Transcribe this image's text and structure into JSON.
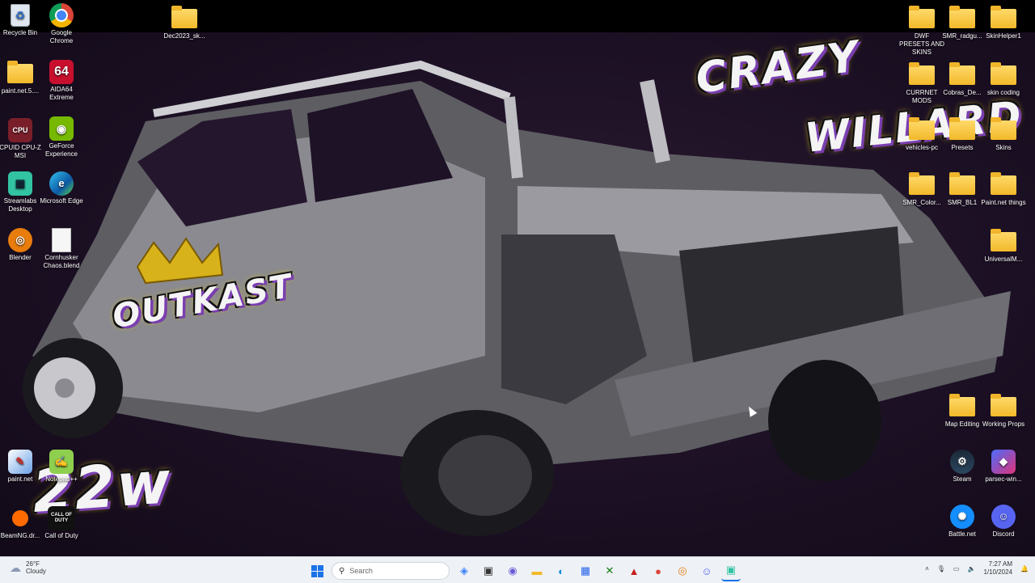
{
  "wallpaper": {
    "title_line1": "CRAZY",
    "title_line2": "WILLARD",
    "badge_text": "OUTKAST",
    "number_text": "22w",
    "accent_color": "#7a3fb0",
    "highlight_color": "#d8c21a"
  },
  "desktop_icons_left": [
    {
      "label": "Recycle Bin",
      "icon": "recycle-bin-icon"
    },
    {
      "label": "Google Chrome",
      "icon": "chrome-icon"
    },
    {
      "label": "paint.net.5....",
      "icon": "folder-icon"
    },
    {
      "label": "AIDA64 Extreme",
      "icon": "aida64-icon",
      "glyph": "64"
    },
    {
      "label": "CPUID CPU-Z MSI",
      "icon": "cpuz-icon"
    },
    {
      "label": "GeForce Experience",
      "icon": "nvidia-icon"
    },
    {
      "label": "Streamlabs Desktop",
      "icon": "streamlabs-icon"
    },
    {
      "label": "Microsoft Edge",
      "icon": "edge-icon"
    },
    {
      "label": "Blender",
      "icon": "blender-icon"
    },
    {
      "label": "Cornhusker Chaos.blend",
      "icon": "blend-file-icon"
    },
    {
      "label": "paint.net",
      "icon": "paintnet-icon"
    },
    {
      "label": "Notepad++",
      "icon": "notepadpp-icon"
    },
    {
      "label": "BeamNG.dr...",
      "icon": "beamng-icon"
    },
    {
      "label": "Call of Duty",
      "icon": "cod-icon",
      "glyph": "CALL OF DUTY"
    }
  ],
  "desktop_icon_top": {
    "label": "Dec2023_sk...",
    "icon": "folder-icon"
  },
  "desktop_icons_right": [
    {
      "label": "DWF PRESETS AND SKINS",
      "icon": "folder-icon"
    },
    {
      "label": "SMR_radgu...",
      "icon": "folder-icon"
    },
    {
      "label": "SkinHelper1",
      "icon": "folder-icon"
    },
    {
      "label": "CURRNET MODS",
      "icon": "folder-icon"
    },
    {
      "label": "Cobras_De...",
      "icon": "folder-icon"
    },
    {
      "label": "skin coding",
      "icon": "folder-icon"
    },
    {
      "label": "vehicles-pc",
      "icon": "folder-icon"
    },
    {
      "label": "Presets",
      "icon": "folder-icon"
    },
    {
      "label": "Skins",
      "icon": "folder-icon"
    },
    {
      "label": "SMR_Color...",
      "icon": "folder-icon"
    },
    {
      "label": "SMR_BL1",
      "icon": "folder-icon"
    },
    {
      "label": "Paint.net things",
      "icon": "folder-icon"
    },
    {
      "label": "UniversalM...",
      "icon": "folder-icon"
    },
    {
      "label": "Map Editing",
      "icon": "folder-icon"
    },
    {
      "label": "Working Props",
      "icon": "folder-icon"
    },
    {
      "label": "Steam",
      "icon": "steam-icon"
    },
    {
      "label": "parsec-win...",
      "icon": "parsec-icon"
    },
    {
      "label": "Battle.net",
      "icon": "battlenet-icon"
    },
    {
      "label": "Discord",
      "icon": "discord-icon"
    }
  ],
  "taskbar": {
    "weather_temp": "26°F",
    "weather_desc": "Cloudy",
    "search_placeholder": "Search",
    "clock_time": "7:27 AM",
    "clock_date": "1/10/2024"
  }
}
